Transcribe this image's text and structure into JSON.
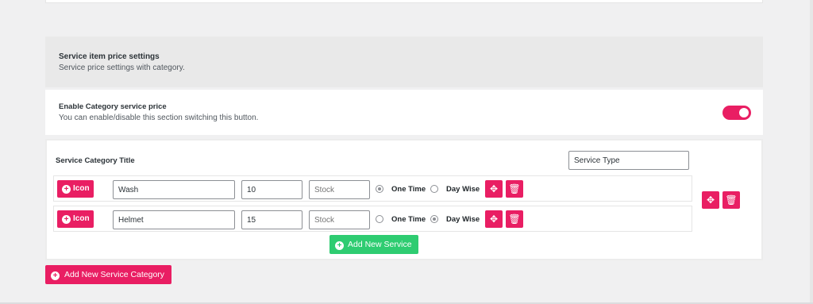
{
  "section": {
    "title": "Service item price settings",
    "subtitle": "Service price settings with category."
  },
  "enable": {
    "title": "Enable Category service price",
    "subtitle": "You can enable/disable this section switching this button.",
    "toggle_on": true
  },
  "category": {
    "title_label": "Service Category Title",
    "service_type_value": "Service Type",
    "icon_label": "Icon",
    "radio_one_time": "One Time",
    "radio_day_wise": "Day Wise",
    "stock_placeholder": "Stock",
    "add_service_label": "Add New Service",
    "rows": [
      {
        "name": "Wash",
        "price": "10",
        "stock": "",
        "selected": "one_time"
      },
      {
        "name": "Helmet",
        "price": "15",
        "stock": "",
        "selected": "day_wise"
      }
    ]
  },
  "add_category_label": "Add New Service Category",
  "colors": {
    "accent_pink": "#e91e63",
    "accent_green": "#2ecc71"
  }
}
